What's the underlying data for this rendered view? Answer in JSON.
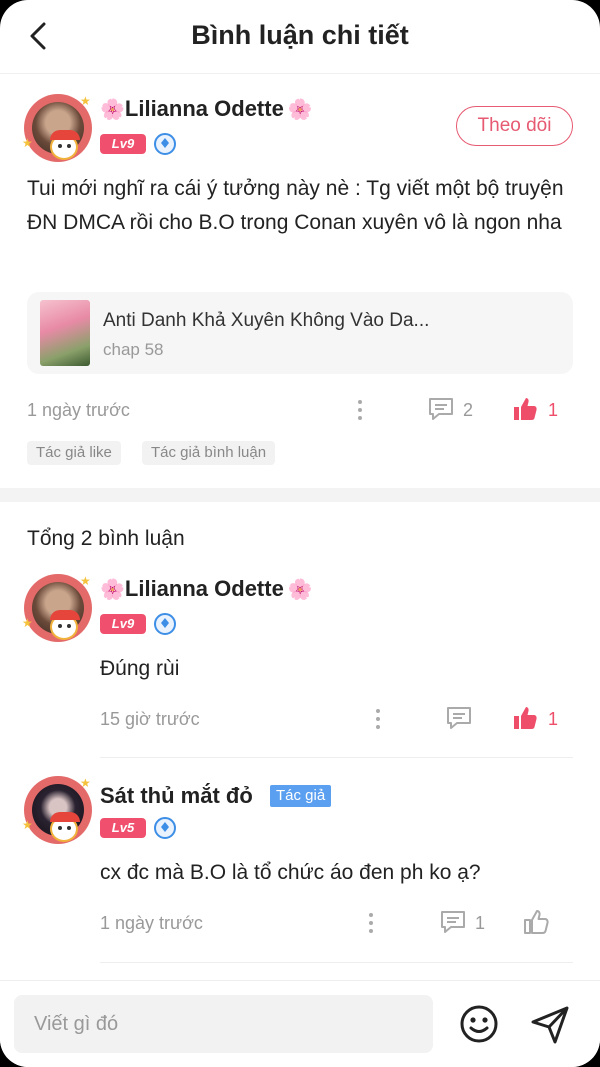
{
  "header": {
    "title": "Bình luận chi tiết",
    "back_icon": "chevron-left-icon"
  },
  "post": {
    "author": {
      "name": "Lilianna Odette",
      "flower": "🌸",
      "level": "Lv9"
    },
    "follow_label": "Theo dõi",
    "text": "Tui mới nghĩ ra cái ý tưởng này nè : Tg viết một bộ truyện ĐN DMCA rồi cho B.O trong Conan xuyên vô là ngon nha",
    "story": {
      "title": "Anti Danh Khả Xuyên Không Vào Da...",
      "chapter": "chap 58"
    },
    "time": "1 ngày trước",
    "comment_count": "2",
    "like_count": "1",
    "tags": [
      "Tác giả like",
      "Tác giả bình luận"
    ]
  },
  "comments_section": {
    "total_label": "Tổng 2 bình luận",
    "comments": [
      {
        "name": "Lilianna Odette",
        "flower": "🌸",
        "level": "Lv9",
        "text": "Đúng rùi",
        "time": "15 giờ trước",
        "like_count": "1"
      },
      {
        "name": "Sát thủ mắt đỏ",
        "author_badge": "Tác giả",
        "level": "Lv5",
        "text": "cx đc mà B.O là tổ chức áo đen ph ko ạ?",
        "time": "1 ngày trước",
        "comment_count": "1"
      }
    ]
  },
  "composer": {
    "placeholder": "Viết gì đó"
  },
  "colors": {
    "accent": "#e65a72",
    "level_badge": "#f0506e",
    "author_badge": "#5b9ff0"
  }
}
